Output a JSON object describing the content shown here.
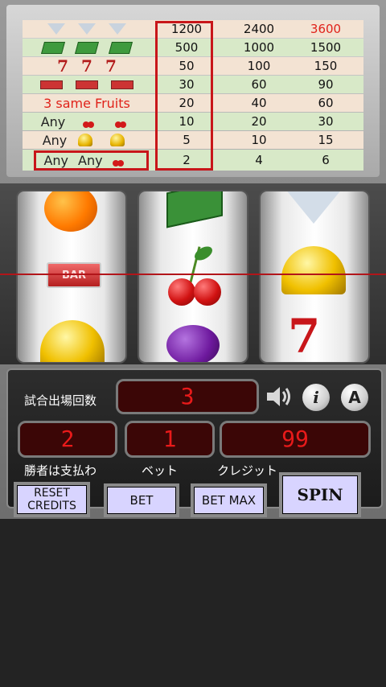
{
  "paytable": {
    "rows": [
      {
        "symbols": [
          "diamond",
          "diamond",
          "diamond"
        ],
        "pays": [
          "1200",
          "2400",
          "3600"
        ]
      },
      {
        "symbols": [
          "cash",
          "cash",
          "cash"
        ],
        "pays": [
          "500",
          "1000",
          "1500"
        ]
      },
      {
        "symbols": [
          "seven",
          "seven",
          "seven"
        ],
        "pays": [
          "50",
          "100",
          "150"
        ]
      },
      {
        "symbols": [
          "bar",
          "bar",
          "bar"
        ],
        "pays": [
          "30",
          "60",
          "90"
        ]
      },
      {
        "label": "3 same Fruits",
        "pays": [
          "20",
          "40",
          "60"
        ]
      },
      {
        "label": "Any",
        "symbols": [
          "cherry",
          "cherry"
        ],
        "pays": [
          "10",
          "20",
          "30"
        ]
      },
      {
        "label": "Any",
        "symbols": [
          "bell",
          "bell"
        ],
        "pays": [
          "5",
          "10",
          "15"
        ]
      },
      {
        "label": "Any",
        "label2": "Any",
        "symbols": [
          "cherry"
        ],
        "pays": [
          "2",
          "4",
          "6"
        ]
      }
    ],
    "seven_glyph": "7",
    "highlight_color": "#c8161a",
    "top_pay_color": "#e0221a"
  },
  "reels": {
    "reel1": [
      "orange",
      "bar",
      "bell"
    ],
    "reel2": [
      "cash",
      "cherries",
      "plum"
    ],
    "reel3": [
      "diamond",
      "bell",
      "seven"
    ],
    "bar_text": "BAR",
    "seven_text": "7"
  },
  "panel": {
    "games_label": "試合出場回数",
    "games_value": "3",
    "winner_pays_label": "勝者は支払わ",
    "winner_pays_value": "2",
    "bet_label": "ベット",
    "bet_value": "1",
    "credit_label": "クレジット",
    "credit_value": "99",
    "info_icon": "i",
    "font_icon": "A",
    "lcd_color": "#e81a1a"
  },
  "buttons": {
    "reset_line1": "RESET",
    "reset_line2": "CREDITS",
    "bet": "BET",
    "bet_max": "BET MAX",
    "spin": "SPIN"
  }
}
